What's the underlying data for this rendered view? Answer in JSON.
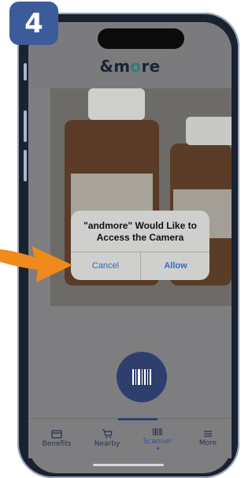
{
  "step": {
    "number": "4"
  },
  "status": {
    "time": ""
  },
  "header": {
    "logo_left": "&m",
    "logo_dot": "o",
    "logo_right": "re"
  },
  "dialog": {
    "title": "\"andmore\" Would Like to Access the Camera",
    "cancel_label": "Cancel",
    "allow_label": "Allow"
  },
  "tabbar": {
    "items": [
      {
        "label": "Benefits",
        "icon": "card-icon",
        "active": false
      },
      {
        "label": "Nearby",
        "icon": "cart-icon",
        "active": false
      },
      {
        "label": "Scanner",
        "icon": "barcode-icon",
        "active": true
      },
      {
        "label": "More",
        "icon": "menu-icon",
        "active": false
      }
    ]
  },
  "colors": {
    "brand_blue": "#3c5b9a",
    "arrow_orange": "#f08a1c",
    "fab_blue": "#2e3f6e",
    "dialog_link": "#2f6ac9"
  }
}
